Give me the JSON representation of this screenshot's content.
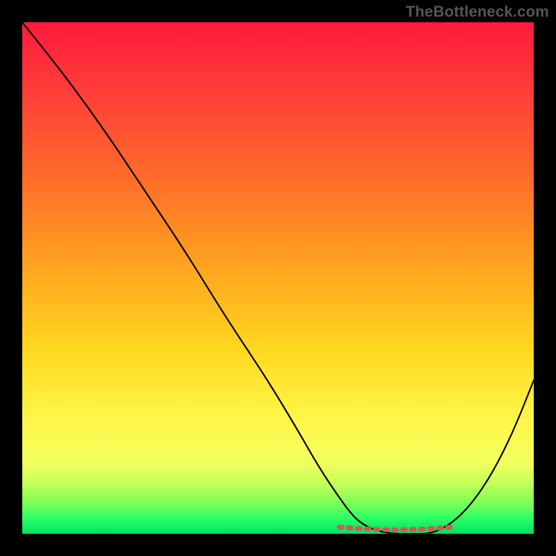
{
  "watermark": "TheBottleneck.com",
  "chart_data": {
    "type": "line",
    "title": "",
    "xlabel": "",
    "ylabel": "",
    "xlim": [
      0,
      100
    ],
    "ylim": [
      0,
      100
    ],
    "series": [
      {
        "name": "bottleneck-curve",
        "x": [
          0,
          8,
          16,
          24,
          32,
          40,
          48,
          54,
          58,
          62,
          65,
          68,
          72,
          76,
          80,
          84,
          88,
          92,
          96,
          100
        ],
        "values": [
          100,
          90,
          79,
          67,
          55,
          42,
          30,
          20,
          13,
          7,
          3,
          1,
          0,
          0,
          0,
          2,
          6,
          12,
          20,
          30
        ]
      }
    ],
    "bottom_marker": {
      "name": "optimal-range-marker",
      "color": "#cc5b57",
      "x_start": 62,
      "x_end": 84,
      "y": 0.8
    },
    "gradient_stops": [
      {
        "pos": 0,
        "color": "#ff1a3c"
      },
      {
        "pos": 12,
        "color": "#ff3a3a"
      },
      {
        "pos": 30,
        "color": "#ff6a2a"
      },
      {
        "pos": 48,
        "color": "#ffa51f"
      },
      {
        "pos": 64,
        "color": "#ffd81f"
      },
      {
        "pos": 78,
        "color": "#fff74a"
      },
      {
        "pos": 86,
        "color": "#f2ff5e"
      },
      {
        "pos": 90,
        "color": "#c8ff5a"
      },
      {
        "pos": 94,
        "color": "#7dff57"
      },
      {
        "pos": 97,
        "color": "#2bff66"
      },
      {
        "pos": 100,
        "color": "#00e060"
      }
    ]
  }
}
